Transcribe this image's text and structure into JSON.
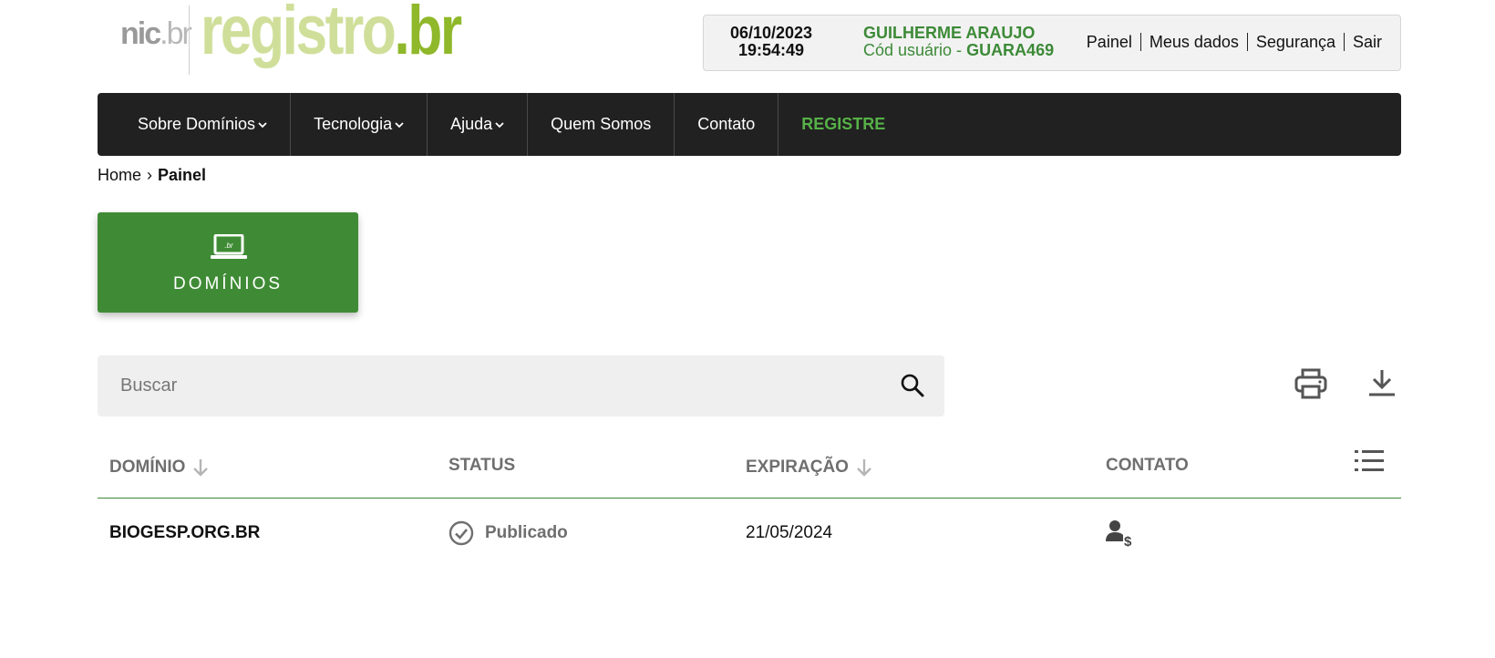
{
  "logo": {
    "nic": "nic",
    "nic_br": ".br",
    "registro": "registro",
    "registro_br": ".br"
  },
  "userbox": {
    "date": "06/10/2023",
    "time": "19:54:49",
    "user_name": "GUILHERME ARAUJO",
    "code_label": "Cód usuário - ",
    "code_value": "GUARA469",
    "links": [
      "Painel",
      "Meus dados",
      "Segurança",
      "Sair"
    ]
  },
  "nav": {
    "items": [
      {
        "label": "Sobre Domínios"
      },
      {
        "label": "Tecnologia"
      },
      {
        "label": "Ajuda"
      },
      {
        "label": "Quem Somos"
      },
      {
        "label": "Contato"
      },
      {
        "label": "REGISTRE"
      }
    ],
    "dropdown_glyph": "‹"
  },
  "breadcrumb": {
    "home": "Home",
    "separator": "›",
    "current": "Painel"
  },
  "tile": {
    "label": "DOMÍNIOS",
    "icon_text": ".br"
  },
  "search": {
    "placeholder": "Buscar",
    "value": ""
  },
  "table": {
    "headers": {
      "domain": "DOMÍNIO",
      "status": "STATUS",
      "expiration": "EXPIRAÇÃO",
      "contact": "CONTATO"
    },
    "rows": [
      {
        "domain": "BIOGESP.ORG.BR",
        "status": "Publicado",
        "expiration": "21/05/2024"
      }
    ]
  },
  "colors": {
    "green": "#3f8b35",
    "nav_bg": "#212121",
    "accent_green": "#56b147"
  }
}
